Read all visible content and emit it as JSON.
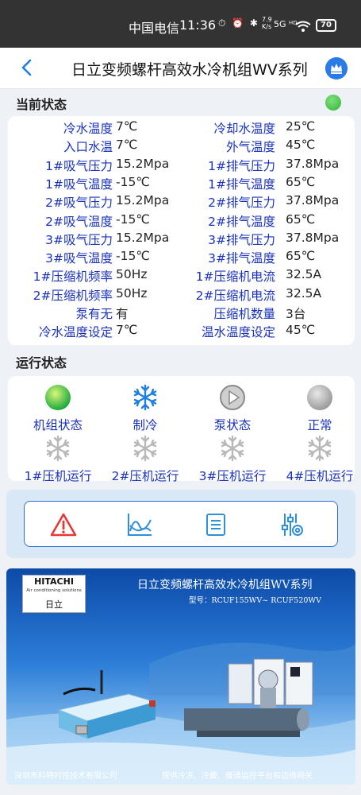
{
  "status_bar": {
    "carrier": "中国电信",
    "time": "11:36",
    "icons": "⏱ ⏰ ✱",
    "speed_value": "7.9",
    "speed_unit": "K/s",
    "network": "5G ᴴᴰ",
    "battery": "70"
  },
  "header": {
    "title": "日立变频螺杆高效水冷机组WV系列"
  },
  "current_state": {
    "section_title": "当前状态",
    "indicator_color": "#3fbf3f",
    "rows": [
      {
        "l_label": "冷水温度",
        "l_value": "7℃",
        "r_label": "冷却水温度",
        "r_value": "25℃"
      },
      {
        "l_label": "入口水温",
        "l_value": "7℃",
        "r_label": "外气温度",
        "r_value": "45℃"
      },
      {
        "l_label": "1#吸气压力",
        "l_value": "15.2Mpa",
        "r_label": "1#排气压力",
        "r_value": "37.8Mpa"
      },
      {
        "l_label": "1#吸气温度",
        "l_value": "-15℃",
        "r_label": "1#排气温度",
        "r_value": "65℃"
      },
      {
        "l_label": "2#吸气压力",
        "l_value": "15.2Mpa",
        "r_label": "2#排气压力",
        "r_value": "37.8Mpa"
      },
      {
        "l_label": "2#吸气温度",
        "l_value": "-15℃",
        "r_label": "2#排气温度",
        "r_value": "65℃"
      },
      {
        "l_label": "3#吸气压力",
        "l_value": "15.2Mpa",
        "r_label": "3#排气压力",
        "r_value": "37.8Mpa"
      },
      {
        "l_label": "3#吸气温度",
        "l_value": "-15℃",
        "r_label": "3#排气温度",
        "r_value": "65℃"
      },
      {
        "l_label": "1#压缩机频率",
        "l_value": "50Hz",
        "r_label": "1#压缩机电流",
        "r_value": "32.5A"
      },
      {
        "l_label": "2#压缩机频率",
        "l_value": "50Hz",
        "r_label": "2#压缩机电流",
        "r_value": "32.5A"
      },
      {
        "l_label": "泵有无",
        "l_value": "有",
        "r_label": "压缩机数量",
        "r_value": "3台"
      },
      {
        "l_label": "冷水温度设定",
        "l_value": "7℃",
        "r_label": "温水温度设定",
        "r_value": "45℃"
      }
    ]
  },
  "run_state": {
    "section_title": "运行状态",
    "items": [
      {
        "label": "机组状态",
        "icon": "green-status-ball-icon"
      },
      {
        "label": "制冷",
        "icon": "snowflake-icon"
      },
      {
        "label": "泵状态",
        "icon": "play-circle-icon"
      },
      {
        "label": "正常",
        "icon": "gray-status-ball-icon"
      },
      {
        "label": "1#压机运行",
        "icon": "snowflake-gray-icon"
      },
      {
        "label": "2#压机运行",
        "icon": "snowflake-gray-icon"
      },
      {
        "label": "3#压机运行",
        "icon": "snowflake-gray-icon"
      },
      {
        "label": "4#压机运行",
        "icon": "snowflake-gray-icon"
      }
    ]
  },
  "toolbar": {
    "buttons": [
      {
        "icon": "alarm-warning-icon",
        "color": "#e53935"
      },
      {
        "icon": "trend-chart-icon",
        "color": "#2f8fd8"
      },
      {
        "icon": "list-document-icon",
        "color": "#2f8fd8"
      },
      {
        "icon": "settings-sliders-icon",
        "color": "#2f8fd8"
      }
    ]
  },
  "banner": {
    "brand": "HITACHI",
    "brand_sub": "Air conditioning solutions",
    "brand_cn": "日立",
    "title": "日立变频螺杆高效水冷机组WV系列",
    "model": "型号：RCUF155WV~ RCUF520WV",
    "footer_left": "深圳市科特时控技术有限公司",
    "footer_right": "提供冷冻、冷藏、暖通监控平台和边缘网关"
  }
}
